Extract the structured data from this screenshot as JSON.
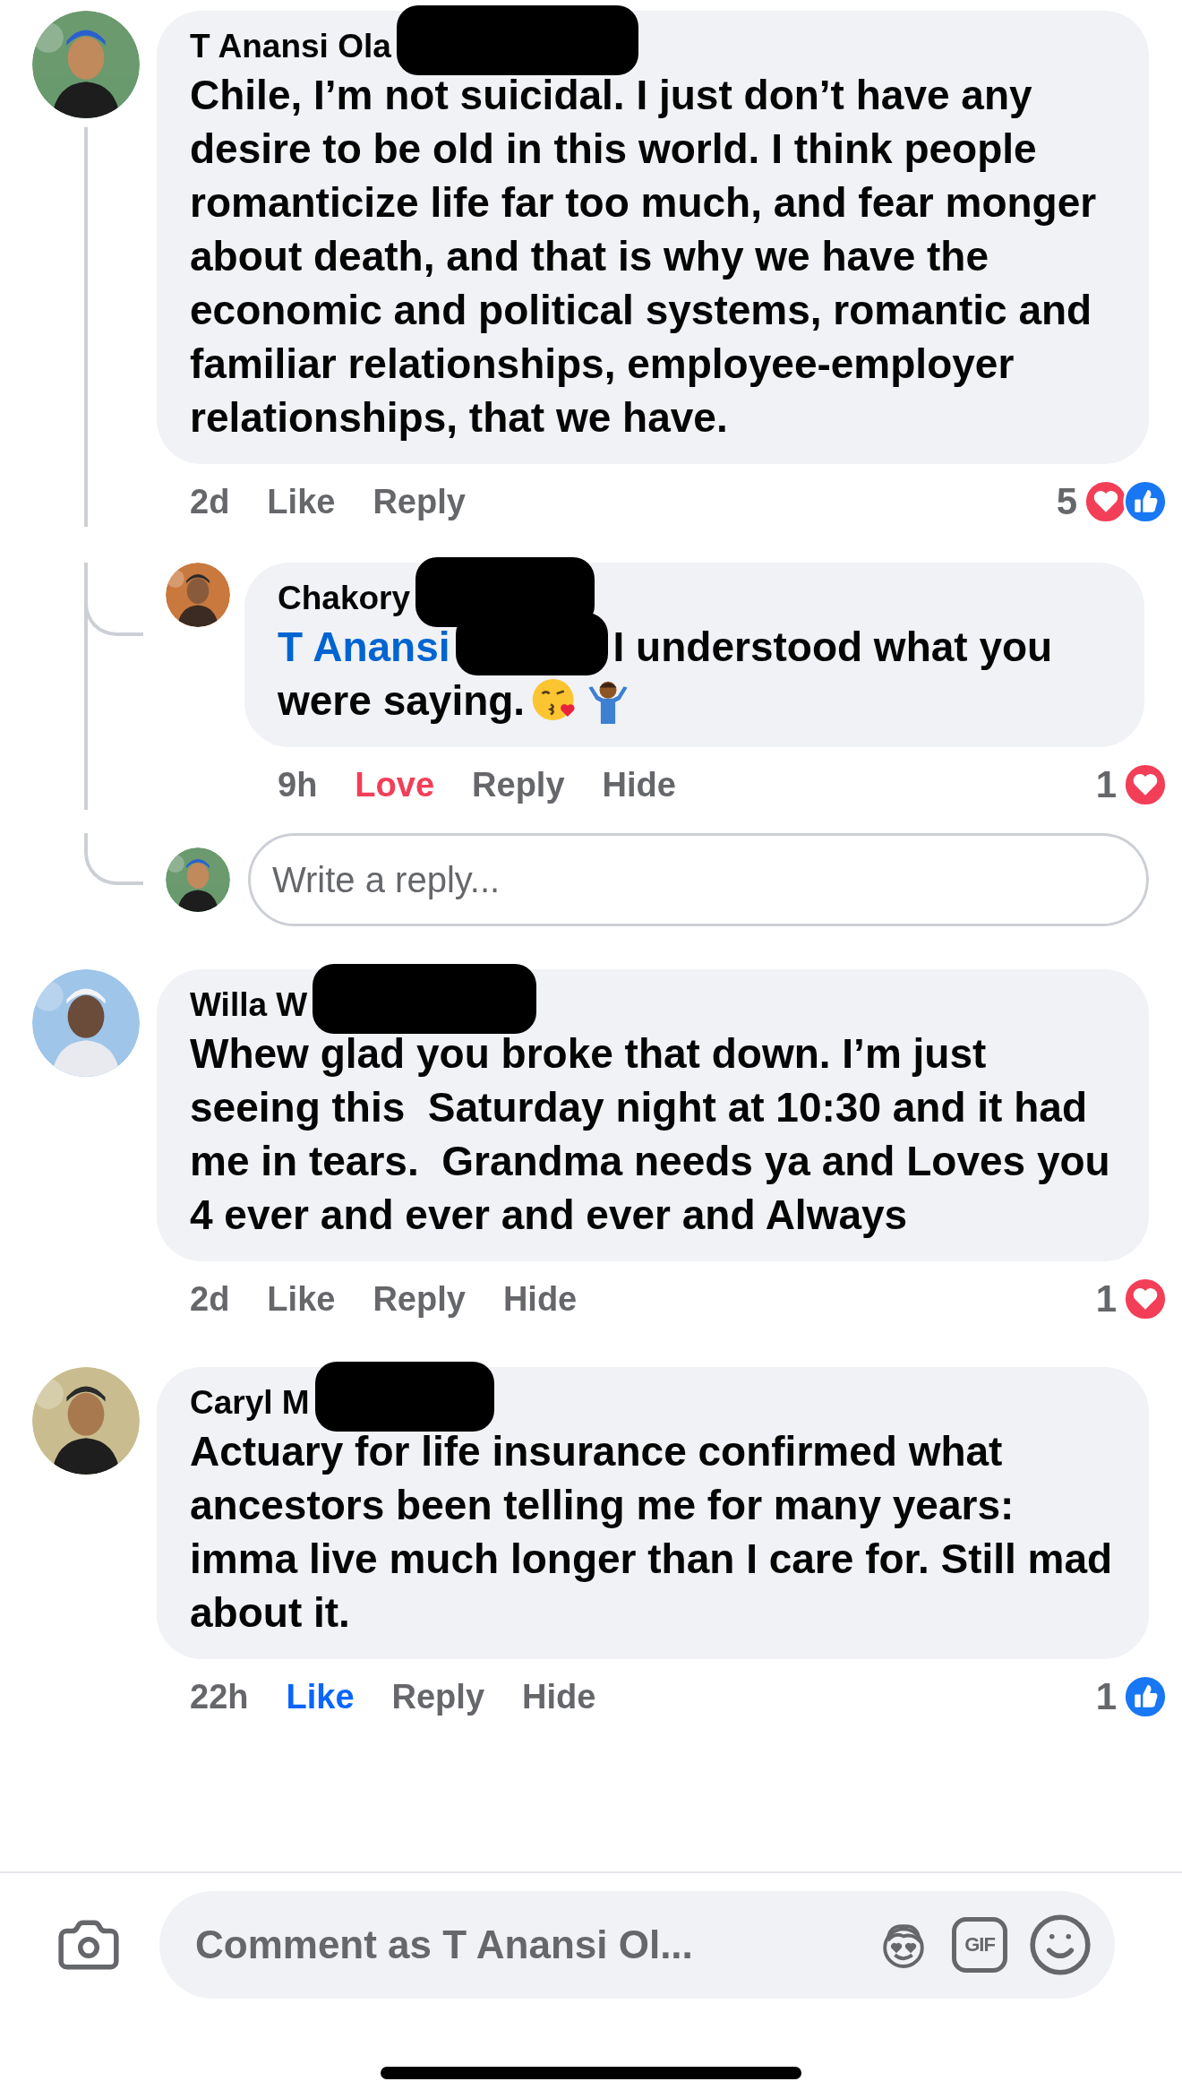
{
  "comments": [
    {
      "author": {
        "name": "T Anansi Ola",
        "redacted": true
      },
      "text": "Chile, I’m not suicidal. I just don’t have any desire to be old in this world. I think people romanticize life far too much, and fear monger about death, and that is why we have the economic and political systems, romantic and familiar relationships, employee-employer relationships, that we have.",
      "time": "2d",
      "actions": [
        {
          "kind": "like",
          "label": "Like",
          "selected": false
        },
        {
          "kind": "reply",
          "label": "Reply"
        }
      ],
      "reactions": {
        "count": "5",
        "love": true,
        "like": true
      },
      "replies": [
        {
          "author": {
            "name": "Chakory",
            "redacted": true
          },
          "mention": {
            "text": "T Anansi",
            "redacted": true
          },
          "text": "I understood what you were saying.",
          "emojis": true,
          "time": "9h",
          "actions": [
            {
              "kind": "love",
              "label": "Love",
              "selected": true
            },
            {
              "kind": "reply",
              "label": "Reply"
            },
            {
              "kind": "hide",
              "label": "Hide"
            }
          ],
          "reactions": {
            "count": "1",
            "love": true,
            "like": false
          }
        }
      ],
      "reply_box": {
        "placeholder": "Write a reply..."
      }
    },
    {
      "author": {
        "name": "Willa W",
        "redacted": true
      },
      "text": "Whew glad you broke that down. I’m just seeing this  Saturday night at 10:30 and it had me in tears.  Grandma needs ya and Loves you 4 ever and ever and ever and Always",
      "time": "2d",
      "actions": [
        {
          "kind": "like",
          "label": "Like",
          "selected": false
        },
        {
          "kind": "reply",
          "label": "Reply"
        },
        {
          "kind": "hide",
          "label": "Hide"
        }
      ],
      "reactions": {
        "count": "1",
        "love": true,
        "like": false
      }
    },
    {
      "author": {
        "name": "Caryl M",
        "redacted": true
      },
      "text": "Actuary for life insurance confirmed what ancestors been telling me for many years: imma live much longer than I care for. Still mad about it.",
      "time": "22h",
      "actions": [
        {
          "kind": "like",
          "label": "Like",
          "selected": true
        },
        {
          "kind": "reply",
          "label": "Reply"
        },
        {
          "kind": "hide",
          "label": "Hide"
        }
      ],
      "reactions": {
        "count": "1",
        "love": false,
        "like": true
      }
    }
  ],
  "composer": {
    "placeholder": "Comment as T Anansi Ol...",
    "gif_label": "GIF"
  }
}
